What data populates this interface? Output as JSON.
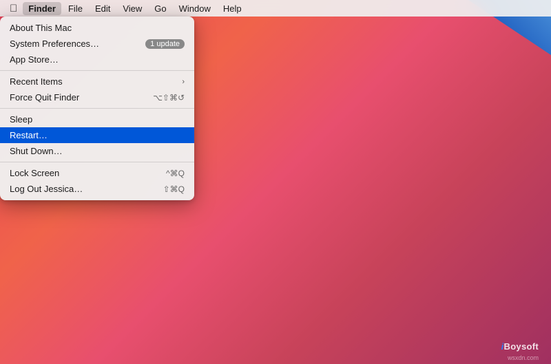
{
  "desktop": {
    "watermark": {
      "brand": "iBoysoft",
      "site": "wsxdn.com"
    }
  },
  "menubar": {
    "items": [
      {
        "id": "apple",
        "label": ""
      },
      {
        "id": "finder",
        "label": "Finder",
        "active": false,
        "bold": true
      },
      {
        "id": "file",
        "label": "File"
      },
      {
        "id": "edit",
        "label": "Edit"
      },
      {
        "id": "view",
        "label": "View"
      },
      {
        "id": "go",
        "label": "Go"
      },
      {
        "id": "window",
        "label": "Window"
      },
      {
        "id": "help",
        "label": "Help"
      }
    ]
  },
  "dropdown": {
    "items": [
      {
        "id": "about-mac",
        "label": "About This Mac",
        "shortcut": "",
        "badge": "",
        "separator_after": false,
        "highlighted": false,
        "has_arrow": false
      },
      {
        "id": "system-prefs",
        "label": "System Preferences…",
        "shortcut": "",
        "badge": "1 update",
        "separator_after": false,
        "highlighted": false,
        "has_arrow": false
      },
      {
        "id": "app-store",
        "label": "App Store…",
        "shortcut": "",
        "badge": "",
        "separator_after": true,
        "highlighted": false,
        "has_arrow": false
      },
      {
        "id": "recent-items",
        "label": "Recent Items",
        "shortcut": "",
        "badge": "",
        "separator_after": false,
        "highlighted": false,
        "has_arrow": true
      },
      {
        "id": "force-quit",
        "label": "Force Quit Finder",
        "shortcut": "⌥⇧⌘↺",
        "badge": "",
        "separator_after": true,
        "highlighted": false,
        "has_arrow": false
      },
      {
        "id": "sleep",
        "label": "Sleep",
        "shortcut": "",
        "badge": "",
        "separator_after": false,
        "highlighted": false,
        "has_arrow": false
      },
      {
        "id": "restart",
        "label": "Restart…",
        "shortcut": "",
        "badge": "",
        "separator_after": false,
        "highlighted": true,
        "has_arrow": false
      },
      {
        "id": "shut-down",
        "label": "Shut Down…",
        "shortcut": "",
        "badge": "",
        "separator_after": true,
        "highlighted": false,
        "has_arrow": false
      },
      {
        "id": "lock-screen",
        "label": "Lock Screen",
        "shortcut": "^⌘Q",
        "badge": "",
        "separator_after": false,
        "highlighted": false,
        "has_arrow": false
      },
      {
        "id": "log-out",
        "label": "Log Out Jessica…",
        "shortcut": "⇧⌘Q",
        "badge": "",
        "separator_after": false,
        "highlighted": false,
        "has_arrow": false
      }
    ]
  }
}
